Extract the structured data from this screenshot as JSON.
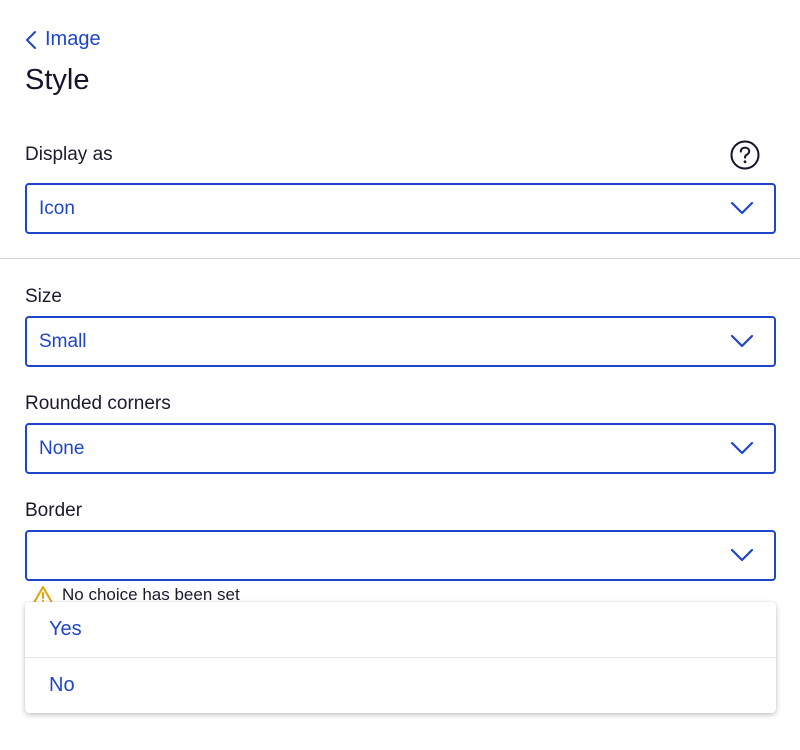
{
  "nav": {
    "back_label": "Image"
  },
  "page": {
    "title": "Style"
  },
  "fields": {
    "display_as": {
      "label": "Display as",
      "value": "Icon"
    },
    "size": {
      "label": "Size",
      "value": "Small"
    },
    "rounded_corners": {
      "label": "Rounded corners",
      "value": "None"
    },
    "border": {
      "label": "Border",
      "value": ""
    }
  },
  "warning": {
    "text": "No choice has been set"
  },
  "dropdown": {
    "options": [
      {
        "label": "Yes"
      },
      {
        "label": "No"
      }
    ]
  },
  "icons": {
    "back": "chevron-left-icon",
    "help": "question-circle-icon",
    "dropdown": "chevron-down-icon",
    "warning": "warning-triangle-icon"
  },
  "colors": {
    "accent": "#1f46c8",
    "warning": "#e2a400",
    "text": "#1a1a2e",
    "divider": "#d4d4d8"
  }
}
